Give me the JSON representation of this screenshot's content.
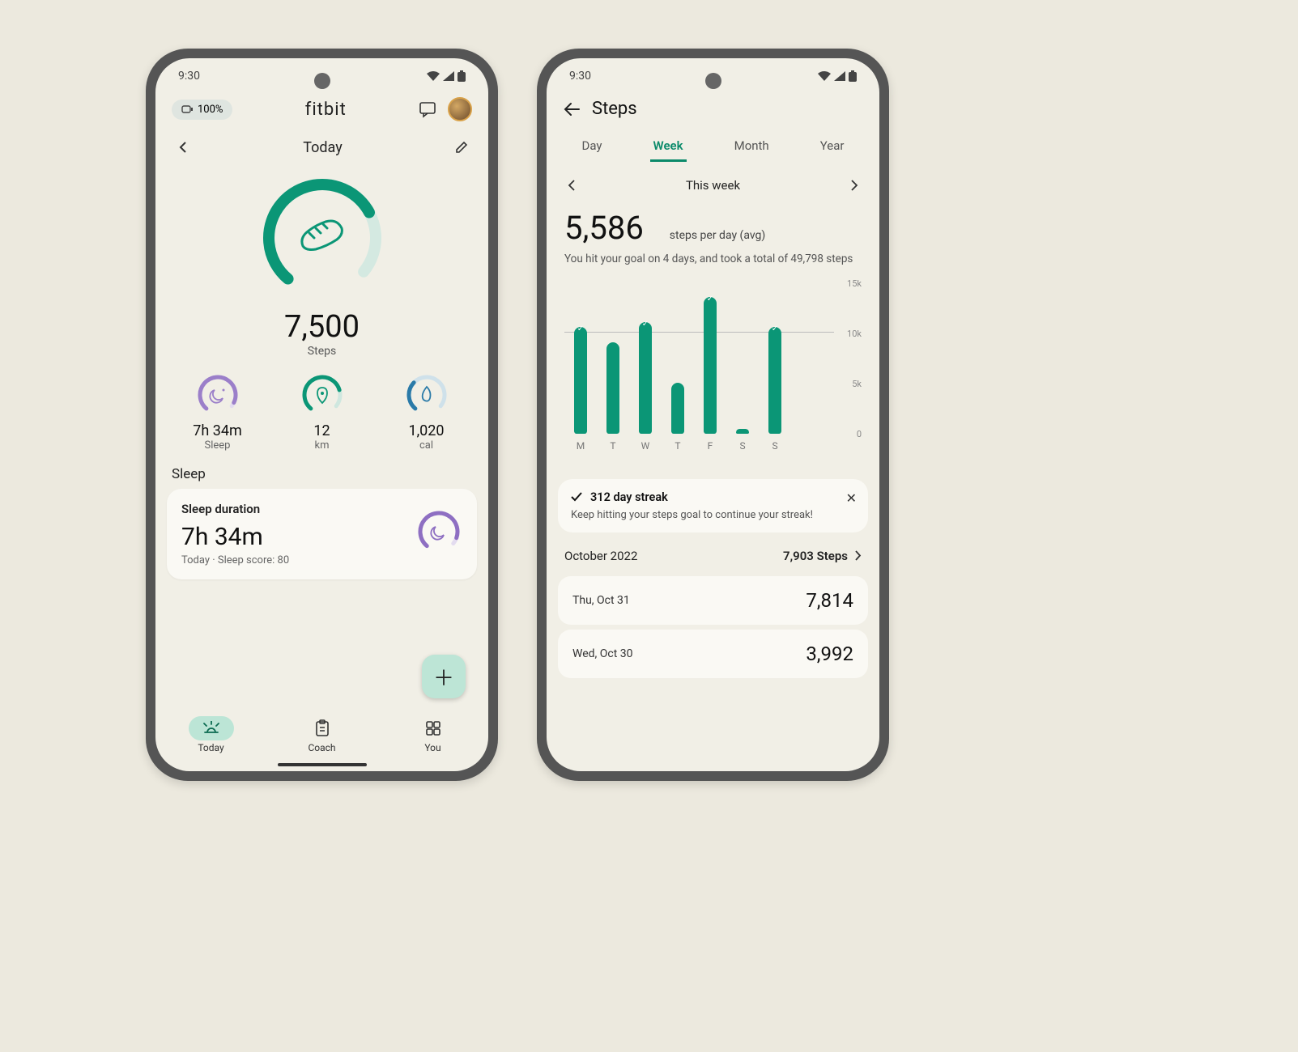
{
  "status_time": "9:30",
  "phone1": {
    "battery": "100%",
    "brand": "fitbit",
    "day_label": "Today",
    "steps_value": "7,500",
    "steps_label": "Steps",
    "minis": [
      {
        "value": "7h 34m",
        "label": "Sleep"
      },
      {
        "value": "12",
        "label": "km"
      },
      {
        "value": "1,020",
        "label": "cal"
      }
    ],
    "sleep_section": "Sleep",
    "sleep_card": {
      "title": "Sleep duration",
      "value": "7h 34m",
      "sub": "Today · Sleep score: 80"
    },
    "nav": [
      {
        "label": "Today"
      },
      {
        "label": "Coach"
      },
      {
        "label": "You"
      }
    ]
  },
  "phone2": {
    "title": "Steps",
    "tabs": [
      "Day",
      "Week",
      "Month",
      "Year"
    ],
    "active_tab": "Week",
    "period_label": "This week",
    "avg_value": "5,586",
    "avg_label": "steps per day (avg)",
    "summary": "You hit your goal on 4 days, and took a total of 49,798 steps",
    "y_ticks": [
      "15k",
      "10k",
      "5k",
      "0"
    ],
    "streak": {
      "title": "312 day streak",
      "sub": "Keep hitting your steps goal to continue your streak!"
    },
    "month": {
      "label": "October 2022",
      "total": "7,903 Steps"
    },
    "days": [
      {
        "label": "Thu, Oct 31",
        "value": "7,814"
      },
      {
        "label": "Wed, Oct 30",
        "value": "3,992"
      }
    ]
  },
  "chart_data": {
    "type": "bar",
    "title": "Steps — This week",
    "xlabel": "",
    "ylabel": "steps",
    "ylim": [
      0,
      15000
    ],
    "goal": 10000,
    "categories": [
      "M",
      "T",
      "W",
      "T",
      "F",
      "S",
      "S"
    ],
    "values": [
      10500,
      9000,
      11000,
      5000,
      13500,
      500,
      10500
    ],
    "goal_hit": [
      true,
      false,
      true,
      false,
      true,
      false,
      true
    ]
  }
}
